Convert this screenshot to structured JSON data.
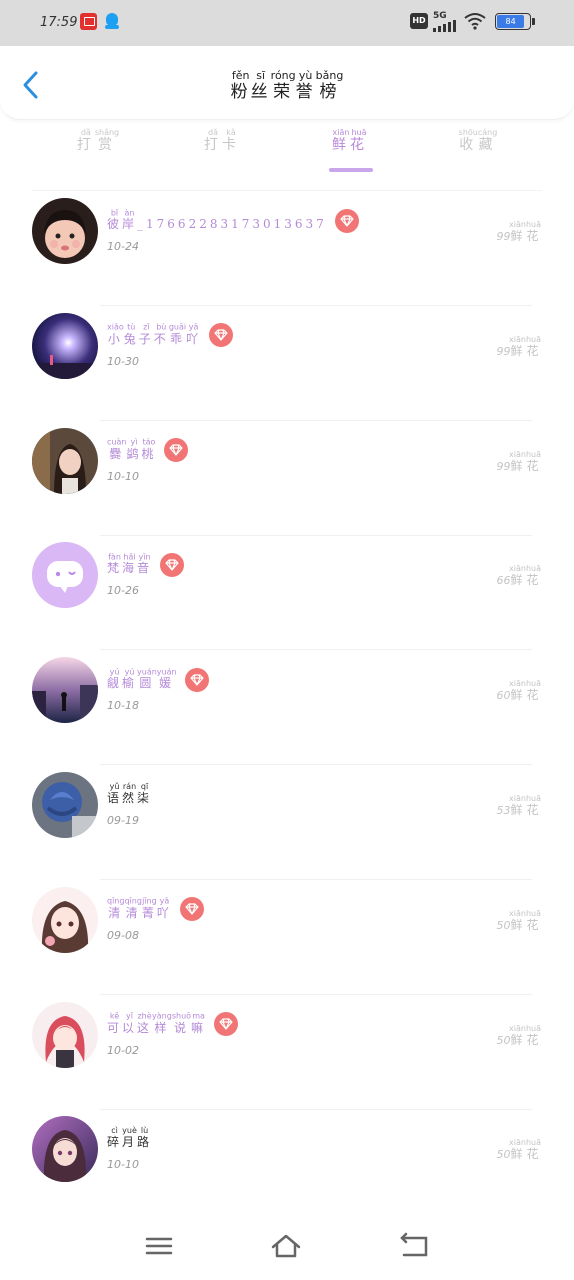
{
  "status_bar": {
    "time": "17:59",
    "network": "5G",
    "hd_label": "HD",
    "battery": "84"
  },
  "header": {
    "title_chars": [
      {
        "han": "粉",
        "py": "fěn"
      },
      {
        "han": "丝",
        "py": "sī"
      },
      {
        "han": "荣",
        "py": "róng"
      },
      {
        "han": "誉",
        "py": "yù"
      },
      {
        "han": "榜",
        "py": "bǎng"
      }
    ],
    "accent_color": "#2b8fe0"
  },
  "tabs": [
    {
      "id": "dashang",
      "chars": [
        {
          "han": "打",
          "py": "dǎ"
        },
        {
          "han": "赏",
          "py": "shǎng"
        }
      ],
      "active": false
    },
    {
      "id": "daka",
      "chars": [
        {
          "han": "打",
          "py": "dǎ"
        },
        {
          "han": "卡",
          "py": "kǎ"
        }
      ],
      "active": false
    },
    {
      "id": "xianhua",
      "chars": [
        {
          "han": "鲜",
          "py": "xiān"
        },
        {
          "han": "花",
          "py": "huā"
        }
      ],
      "active": true
    },
    {
      "id": "shoucang",
      "chars": [
        {
          "han": "收",
          "py": "shōu"
        },
        {
          "han": "藏",
          "py": "cáng"
        }
      ],
      "active": false
    }
  ],
  "unit": {
    "chars": [
      {
        "han": "鲜",
        "py": "xiān"
      },
      {
        "han": "花",
        "py": "huā"
      }
    ]
  },
  "fans": [
    {
      "name": [
        {
          "han": "彼",
          "py": "bǐ"
        },
        {
          "han": "岸",
          "py": "àn"
        },
        {
          "han": "_17662283173013637",
          "py": ""
        }
      ],
      "vip": true,
      "date": "10-24",
      "count": "99",
      "avatar": "girl"
    },
    {
      "name": [
        {
          "han": "小",
          "py": "xiǎo"
        },
        {
          "han": "兔",
          "py": "tù"
        },
        {
          "han": "子",
          "py": "zǐ"
        },
        {
          "han": "不",
          "py": "bù"
        },
        {
          "han": "乖",
          "py": "guāi"
        },
        {
          "han": "吖",
          "py": "yā"
        }
      ],
      "vip": true,
      "date": "10-30",
      "count": "99",
      "avatar": "night"
    },
    {
      "name": [
        {
          "han": "爨",
          "py": "cuàn"
        },
        {
          "han": "鹢",
          "py": "yì"
        },
        {
          "han": "桃",
          "py": "táo"
        }
      ],
      "vip": true,
      "date": "10-10",
      "count": "99",
      "avatar": "cafe"
    },
    {
      "name": [
        {
          "han": "梵",
          "py": "fàn"
        },
        {
          "han": "海",
          "py": "hǎi"
        },
        {
          "han": "音",
          "py": "yīn"
        }
      ],
      "vip": true,
      "date": "10-26",
      "count": "66",
      "avatar": "default"
    },
    {
      "name": [
        {
          "han": "觎",
          "py": "yú"
        },
        {
          "han": "榆",
          "py": "yú"
        },
        {
          "han": "圆",
          "py": "yuán"
        },
        {
          "han": "媛",
          "py": "yuán"
        }
      ],
      "vip": true,
      "date": "10-18",
      "count": "60",
      "avatar": "dusk"
    },
    {
      "name": [
        {
          "han": "语",
          "py": "yǔ"
        },
        {
          "han": "然",
          "py": "rán"
        },
        {
          "han": "柒",
          "py": "qī"
        }
      ],
      "vip": false,
      "date": "09-19",
      "count": "53",
      "avatar": "rose"
    },
    {
      "name": [
        {
          "han": "清",
          "py": "qīng"
        },
        {
          "han": "清",
          "py": "qīng"
        },
        {
          "han": "菁",
          "py": "jīng"
        },
        {
          "han": "吖",
          "py": "yā"
        }
      ],
      "vip": true,
      "date": "09-08",
      "count": "50",
      "avatar": "anime1"
    },
    {
      "name": [
        {
          "han": "可",
          "py": "kě"
        },
        {
          "han": "以",
          "py": "yǐ"
        },
        {
          "han": "这",
          "py": "zhè"
        },
        {
          "han": "样",
          "py": "yàng"
        },
        {
          "han": "说",
          "py": "shuō"
        },
        {
          "han": "嘛",
          "py": "ma"
        }
      ],
      "vip": true,
      "date": "10-02",
      "count": "50",
      "avatar": "anime2"
    },
    {
      "name": [
        {
          "han": "碎",
          "py": "cì"
        },
        {
          "han": "月",
          "py": "yuè"
        },
        {
          "han": "路",
          "py": "lù"
        }
      ],
      "vip": false,
      "date": "10-10",
      "count": "50",
      "avatar": "anime3"
    }
  ],
  "nav": {
    "menu_icon": "menu-icon",
    "home_icon": "home-icon",
    "back_icon": "back-icon"
  }
}
